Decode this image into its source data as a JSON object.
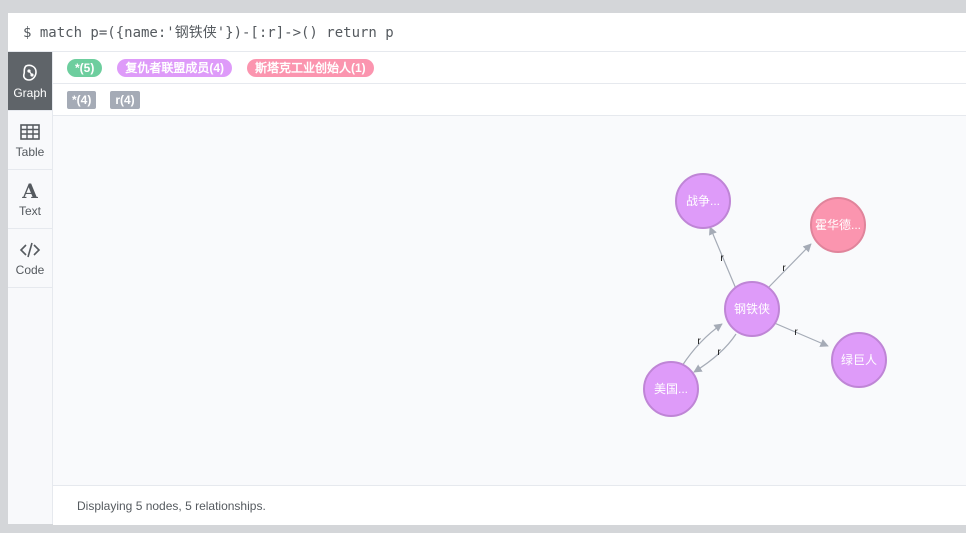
{
  "query": {
    "text": "$ match p=({name:'钢铁侠'})-[:r]->() return p"
  },
  "sidebar": {
    "items": [
      {
        "label": "Graph",
        "icon": "graph-icon",
        "active": true
      },
      {
        "label": "Table",
        "icon": "table-icon",
        "active": false
      },
      {
        "label": "Text",
        "icon": "text-icon",
        "active": false
      },
      {
        "label": "Code",
        "icon": "code-icon",
        "active": false
      }
    ]
  },
  "legend": {
    "labels": [
      {
        "text": "*(5)",
        "color": "#6dce9e"
      },
      {
        "text": "复仇者联盟成员(4)",
        "color": "#de9bf9"
      },
      {
        "text": "斯塔克工业创始人(1)",
        "color": "#fb95af"
      }
    ],
    "relationships": [
      {
        "text": "*(4)",
        "color": "#a5abb6"
      },
      {
        "text": "r(4)",
        "color": "#a5abb6"
      }
    ]
  },
  "graph": {
    "nodes": [
      {
        "id": "n0",
        "label": "钢铁侠",
        "color": "#de9bf9",
        "border": "#bf85d6"
      },
      {
        "id": "n1",
        "label": "战争...",
        "color": "#de9bf9",
        "border": "#bf85d6"
      },
      {
        "id": "n2",
        "label": "霍华德...",
        "color": "#fb95af",
        "border": "#e0849b"
      },
      {
        "id": "n3",
        "label": "绿巨人",
        "color": "#de9bf9",
        "border": "#bf85d6"
      },
      {
        "id": "n4",
        "label": "美国...",
        "color": "#de9bf9",
        "border": "#bf85d6"
      }
    ],
    "relationships": [
      {
        "from": "n0",
        "to": "n1",
        "label": "r"
      },
      {
        "from": "n0",
        "to": "n2",
        "label": "r"
      },
      {
        "from": "n0",
        "to": "n3",
        "label": "r"
      },
      {
        "from": "n0",
        "to": "n4",
        "label": "r"
      },
      {
        "from": "n4",
        "to": "n0",
        "label": "r"
      }
    ]
  },
  "status": {
    "text": "Displaying 5 nodes, 5 relationships."
  }
}
